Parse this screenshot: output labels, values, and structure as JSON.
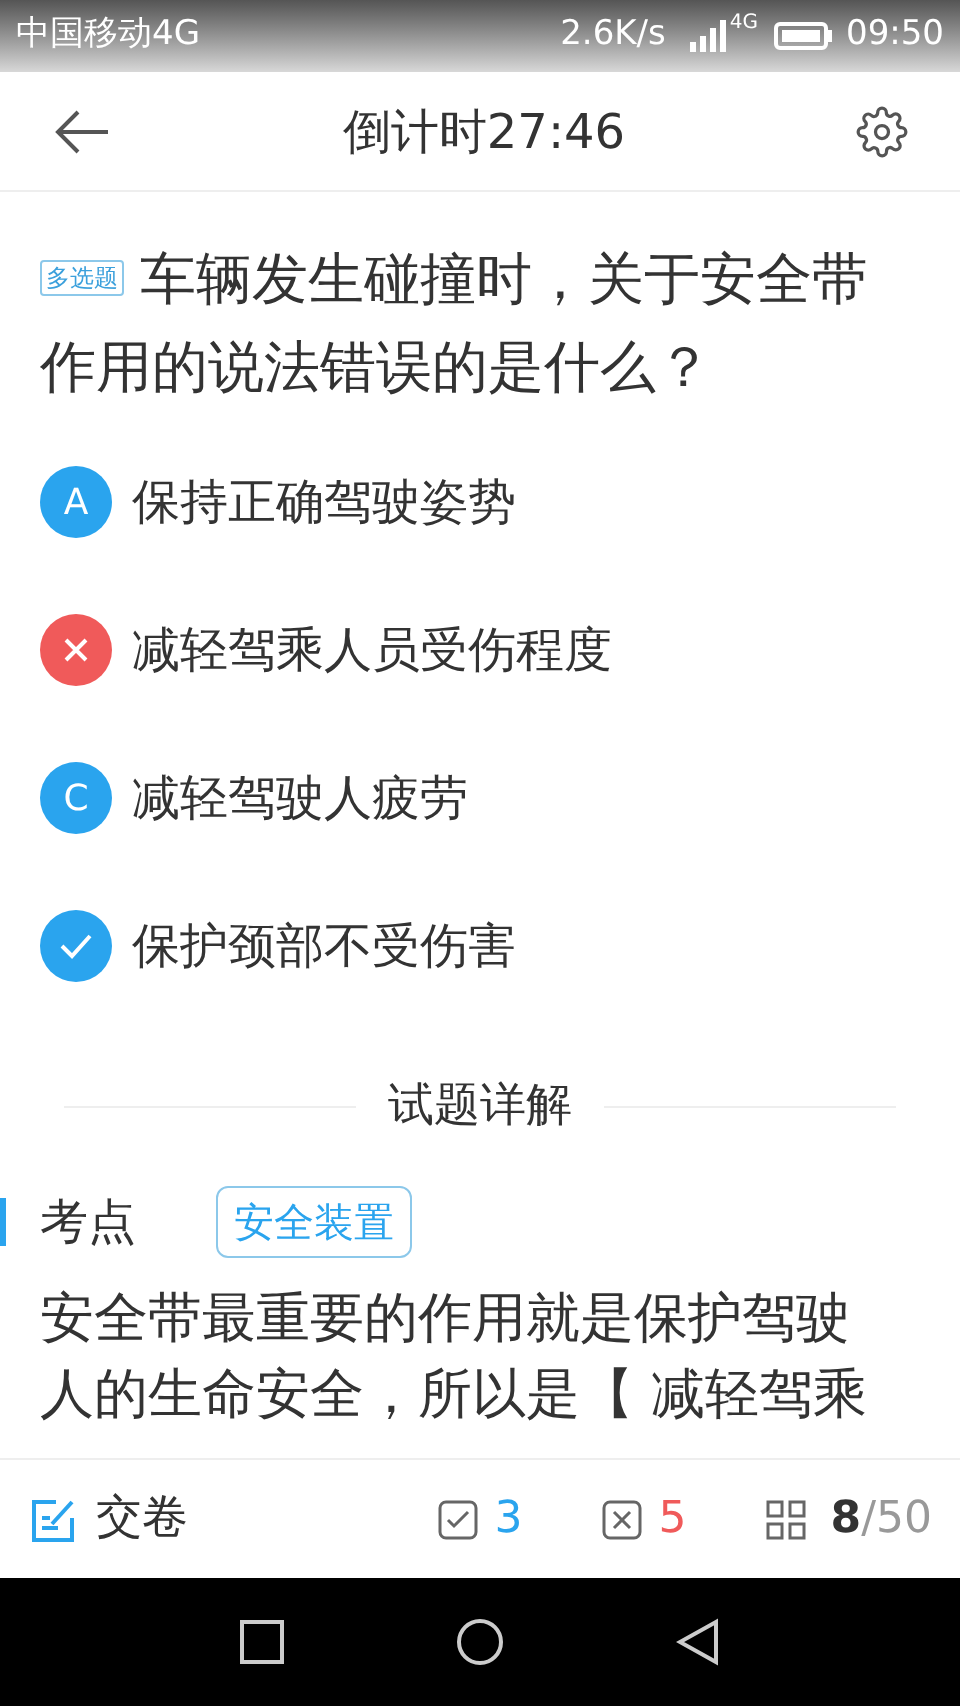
{
  "status_bar": {
    "carrier": "中国移动4G",
    "speed": "2.6K/s",
    "network": "4G",
    "time": "09:50"
  },
  "header": {
    "title": "倒计时27:46"
  },
  "question": {
    "tag": "多选题",
    "text": "车辆发生碰撞时，关于安全带作用的说法错误的是什么？"
  },
  "options": [
    {
      "kind": "letter",
      "letter": "A",
      "text": "保持正确驾驶姿势"
    },
    {
      "kind": "wrong",
      "text": "减轻驾乘人员受伤程度"
    },
    {
      "kind": "letter",
      "letter": "C",
      "text": "减轻驾驶人疲劳"
    },
    {
      "kind": "correct",
      "text": "保护颈部不受伤害"
    }
  ],
  "explanation": {
    "heading": "试题详解",
    "point_label": "考点",
    "point_tag": "安全装置",
    "text": "安全带最重要的作用就是保护驾驶人的生命安全，所以是【 减轻驾乘"
  },
  "bottom_bar": {
    "submit": "交卷",
    "correct_count": "3",
    "wrong_count": "5",
    "current": "8",
    "total": "/50"
  }
}
